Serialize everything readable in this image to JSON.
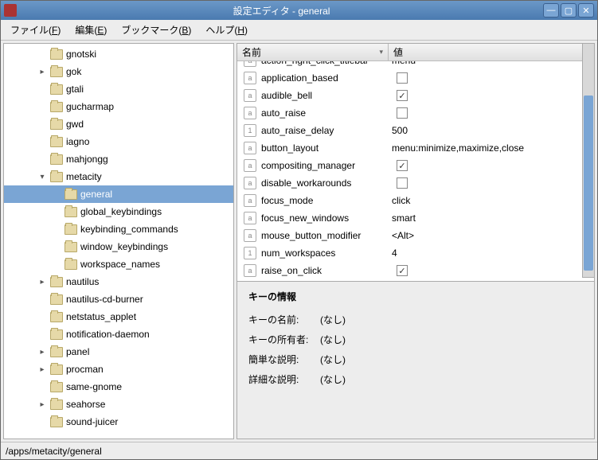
{
  "window": {
    "title": "設定エディタ - general"
  },
  "menu": {
    "file": "ファイル(F)",
    "edit": "編集(E)",
    "bookmarks": "ブックマーク(B)",
    "help": "ヘルプ(H)"
  },
  "tree": [
    {
      "d": 2,
      "e": "",
      "n": "gnotski"
    },
    {
      "d": 2,
      "e": "▸",
      "n": "gok"
    },
    {
      "d": 2,
      "e": "",
      "n": "gtali"
    },
    {
      "d": 2,
      "e": "",
      "n": "gucharmap"
    },
    {
      "d": 2,
      "e": "",
      "n": "gwd"
    },
    {
      "d": 2,
      "e": "",
      "n": "iagno"
    },
    {
      "d": 2,
      "e": "",
      "n": "mahjongg"
    },
    {
      "d": 2,
      "e": "▾",
      "n": "metacity"
    },
    {
      "d": 3,
      "e": "",
      "n": "general",
      "sel": true
    },
    {
      "d": 3,
      "e": "",
      "n": "global_keybindings"
    },
    {
      "d": 3,
      "e": "",
      "n": "keybinding_commands"
    },
    {
      "d": 3,
      "e": "",
      "n": "window_keybindings"
    },
    {
      "d": 3,
      "e": "",
      "n": "workspace_names"
    },
    {
      "d": 2,
      "e": "▸",
      "n": "nautilus"
    },
    {
      "d": 2,
      "e": "",
      "n": "nautilus-cd-burner"
    },
    {
      "d": 2,
      "e": "",
      "n": "netstatus_applet"
    },
    {
      "d": 2,
      "e": "",
      "n": "notification-daemon"
    },
    {
      "d": 2,
      "e": "▸",
      "n": "panel"
    },
    {
      "d": 2,
      "e": "▸",
      "n": "procman"
    },
    {
      "d": 2,
      "e": "",
      "n": "same-gnome"
    },
    {
      "d": 2,
      "e": "▸",
      "n": "seahorse"
    },
    {
      "d": 2,
      "e": "",
      "n": "sound-juicer"
    }
  ],
  "headers": {
    "name": "名前",
    "value": "値"
  },
  "keys": [
    {
      "i": "a",
      "n": "action_right_click_titlebar",
      "v": "menu",
      "cut": true
    },
    {
      "i": "a",
      "n": "application_based",
      "chk": false
    },
    {
      "i": "a",
      "n": "audible_bell",
      "chk": true
    },
    {
      "i": "a",
      "n": "auto_raise",
      "chk": false
    },
    {
      "i": "1",
      "n": "auto_raise_delay",
      "v": "500"
    },
    {
      "i": "a",
      "n": "button_layout",
      "v": "menu:minimize,maximize,close"
    },
    {
      "i": "a",
      "n": "compositing_manager",
      "chk": true
    },
    {
      "i": "a",
      "n": "disable_workarounds",
      "chk": false
    },
    {
      "i": "a",
      "n": "focus_mode",
      "v": "click"
    },
    {
      "i": "a",
      "n": "focus_new_windows",
      "v": "smart"
    },
    {
      "i": "a",
      "n": "mouse_button_modifier",
      "v": "<Alt>"
    },
    {
      "i": "1",
      "n": "num_workspaces",
      "v": "4"
    },
    {
      "i": "a",
      "n": "raise_on_click",
      "chk": true
    }
  ],
  "info": {
    "title": "キーの情報",
    "rows": [
      {
        "l": "キーの名前:",
        "v": "(なし)"
      },
      {
        "l": "キーの所有者:",
        "v": "(なし)"
      },
      {
        "l": "簡単な説明:",
        "v": "(なし)"
      },
      {
        "l": "詳細な説明:",
        "v": "(なし)"
      }
    ]
  },
  "status": "/apps/metacity/general"
}
